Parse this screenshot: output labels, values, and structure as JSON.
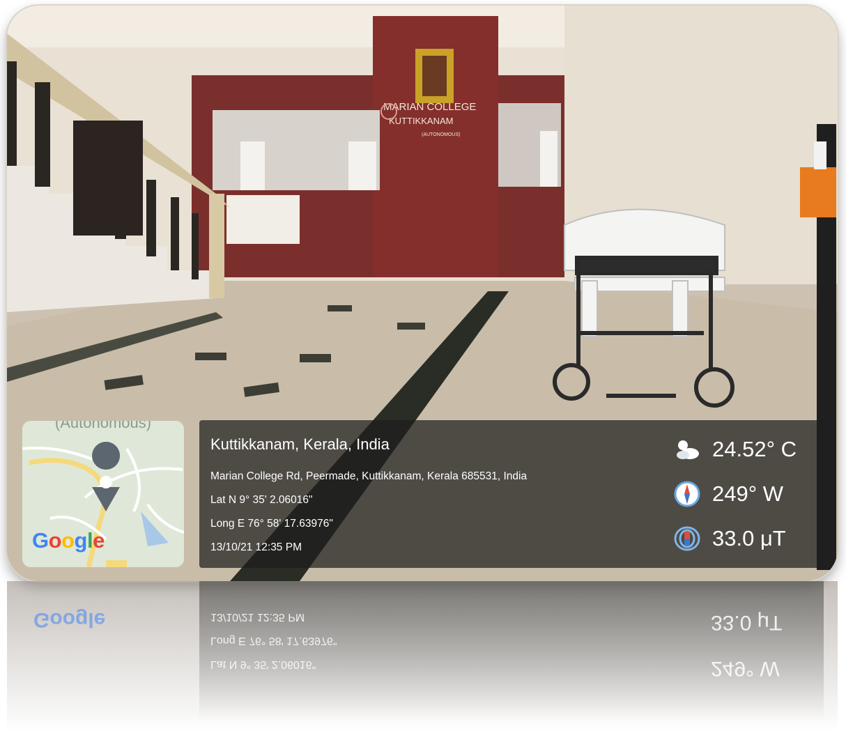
{
  "map": {
    "header_text": "(Autonomous)",
    "logo_text": [
      "G",
      "o",
      "o",
      "g",
      "l",
      "e"
    ]
  },
  "info": {
    "location_title": "Kuttikkanam, Kerala, India",
    "address": "Marian College Rd, Peermade, Kuttikkanam, Kerala 685531, India",
    "latitude": "Lat N 9° 35' 2.06016\"",
    "longitude": "Long E 76° 58' 17.63976\"",
    "timestamp": "13/10/21 12:35 PM"
  },
  "metrics": {
    "temperature": "24.52° C",
    "direction": "249° W",
    "magnetic": "33.0 μT"
  },
  "sign": {
    "line1": "MARIAN COLLEGE",
    "line2": "KUTTIKKANAM",
    "line3": "(AUTONOMOUS)"
  },
  "colors": {
    "panel": "#7a2d2a",
    "overlay": "#1e1e1e",
    "map_bg": "#dfe8d8",
    "road": "#f5d97a",
    "pin": "#5b6670"
  }
}
